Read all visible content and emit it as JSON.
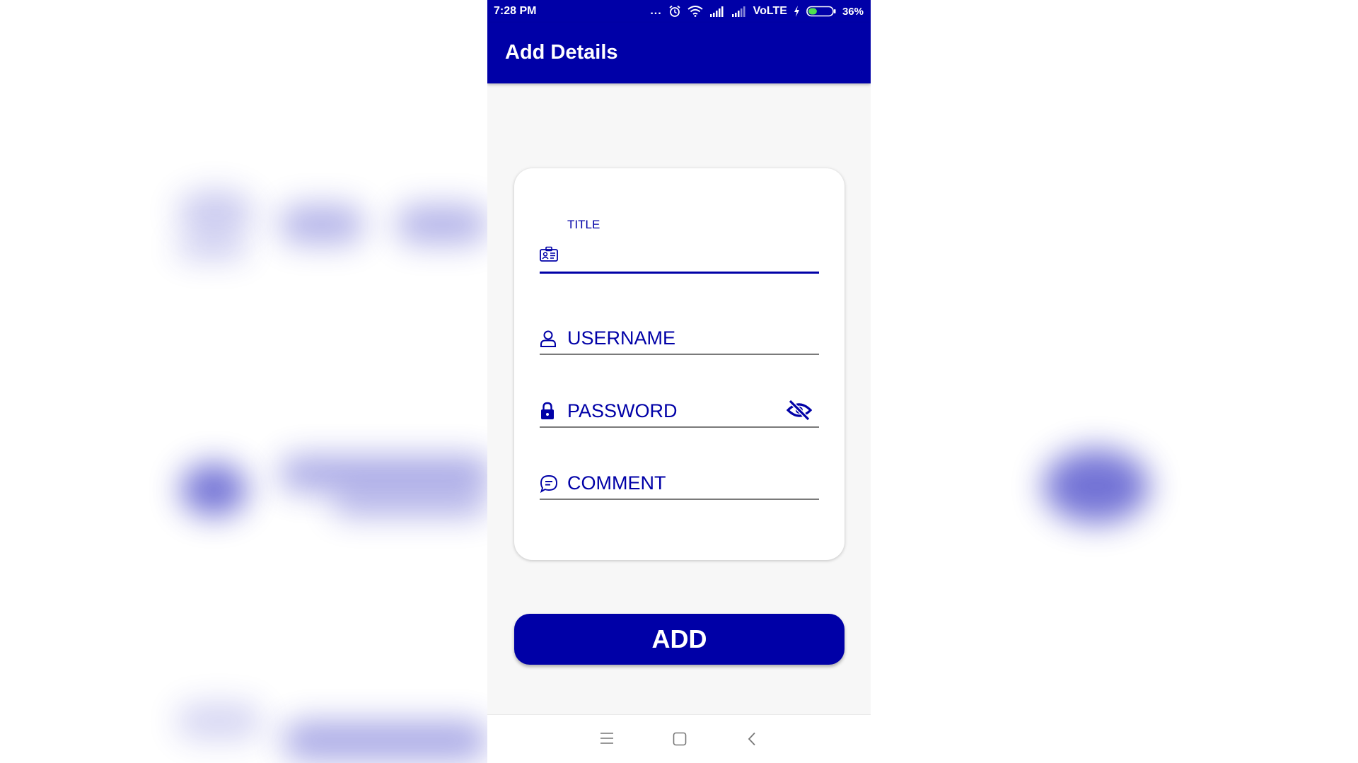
{
  "status_bar": {
    "time": "7:28 PM",
    "dots": "...",
    "network_label": "VoLTE",
    "battery_percent": "36%",
    "battery_level": 0.36
  },
  "app_bar": {
    "title": "Add Details"
  },
  "form": {
    "title_field": {
      "label": "TITLE",
      "value": ""
    },
    "username_field": {
      "placeholder": "USERNAME"
    },
    "password_field": {
      "placeholder": "PASSWORD"
    },
    "comment_field": {
      "placeholder": "COMMENT"
    }
  },
  "add_button": {
    "label": "ADD"
  },
  "colors": {
    "primary": "#0000a7",
    "background": "#f7f7f7",
    "card": "#ffffff"
  }
}
